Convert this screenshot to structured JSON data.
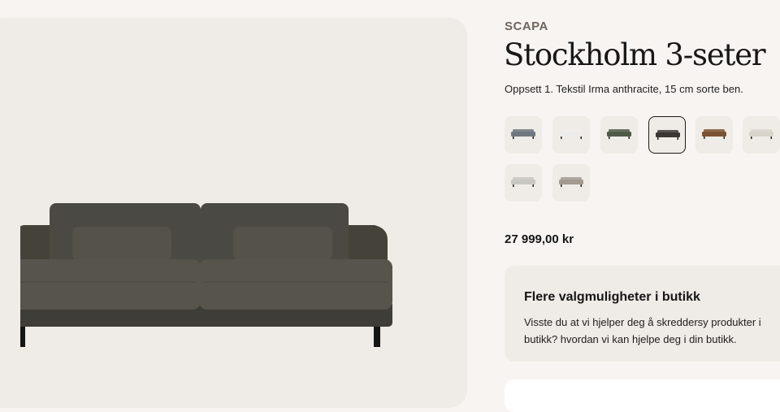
{
  "product": {
    "brand": "SCAPA",
    "title": "Stockholm 3-seter",
    "subtitle": "Oppsett 1. Tekstil Irma anthracite, 15 cm sorte ben.",
    "image": {
      "icon": "sofa-image",
      "fabric_color": "#57544d"
    },
    "price": "27 999,00 kr"
  },
  "swatches": [
    {
      "name": "blue-grey",
      "color": "#6f7780",
      "selected": false
    },
    {
      "name": "white",
      "color": "#eeecea",
      "selected": false
    },
    {
      "name": "green",
      "color": "#4f5a47",
      "selected": false
    },
    {
      "name": "anthracite",
      "color": "#3a3835",
      "selected": true
    },
    {
      "name": "brown",
      "color": "#7b5334",
      "selected": false
    },
    {
      "name": "light-beige",
      "color": "#d8d3cb",
      "selected": false
    },
    {
      "name": "light-grey",
      "color": "#c9c7c1",
      "selected": false
    },
    {
      "name": "taupe",
      "color": "#a59a8f",
      "selected": false
    }
  ],
  "info_box": {
    "title": "Flere valgmuligheter i butikk",
    "text": "Visste du at vi hjelper deg å skreddersy produkter i butikk? hvordan vi kan hjelpe deg i din butikk."
  }
}
